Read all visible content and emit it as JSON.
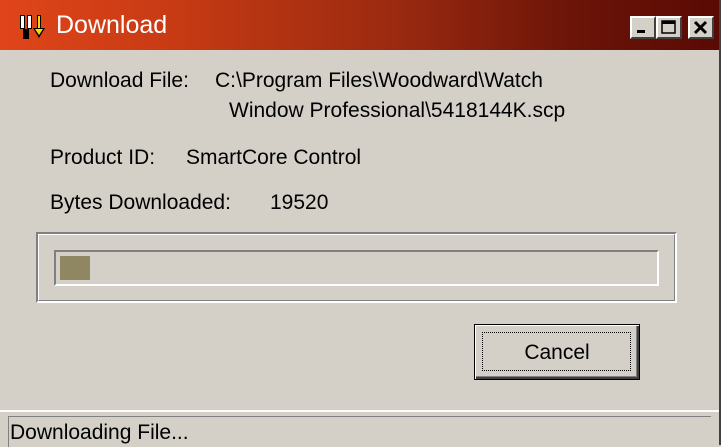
{
  "window": {
    "title": "Download",
    "controls": [
      "minimize",
      "maximize",
      "close"
    ]
  },
  "labels": {
    "download_file_label": "Download File:",
    "download_file_line1": "C:\\Program Files\\Woodward\\Watch",
    "download_file_line2": "Window Professional\\5418144K.scp",
    "product_id_label": "Product ID:",
    "product_id_value": "SmartCore Control",
    "bytes_label": "Bytes Downloaded:",
    "bytes_value": "19520"
  },
  "progress": {
    "fraction": 0.05
  },
  "buttons": {
    "cancel_label": "Cancel"
  },
  "status": {
    "text": "Downloading File..."
  },
  "colors": {
    "title_start": "#e0451a",
    "title_end": "#5a0a04",
    "progress_fill": "#8e8762",
    "face": "#d4d0c8"
  }
}
